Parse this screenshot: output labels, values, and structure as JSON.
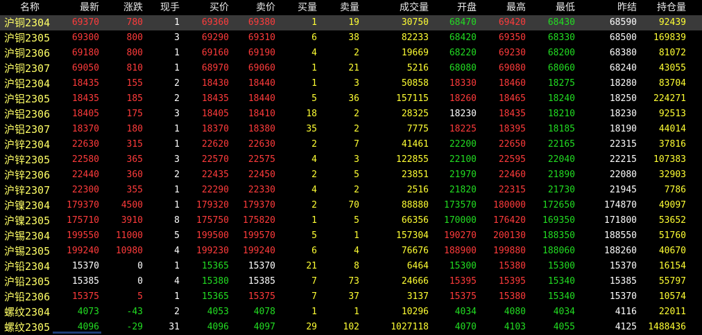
{
  "columns": [
    "名称",
    "最新",
    "涨跌",
    "现手",
    "买价",
    "卖价",
    "买量",
    "卖量",
    "成交量",
    "开盘",
    "最高",
    "最低",
    "昨结",
    "持仓量"
  ],
  "colors": {
    "up": "#ff3b3b",
    "down": "#22dd22",
    "flat": "#ffffff",
    "volume": "#ffff33",
    "name": "#ffff66",
    "selected_bg": "#3a3a3a"
  },
  "selected_row": 0,
  "rows": [
    {
      "name": "沪铜2304",
      "latest": "69370",
      "change": "780",
      "lot": "1",
      "bid": "69360",
      "ask": "69380",
      "bid_vol": "1",
      "ask_vol": "19",
      "volume": "30750",
      "open": "68470",
      "high": "69420",
      "low": "68430",
      "prev_settle": "68590",
      "open_interest": "92439",
      "dir": {
        "latest": "up",
        "change": "up",
        "bid": "up",
        "ask": "up",
        "open": "down",
        "high": "up",
        "low": "down"
      }
    },
    {
      "name": "沪铜2305",
      "latest": "69300",
      "change": "800",
      "lot": "3",
      "bid": "69290",
      "ask": "69310",
      "bid_vol": "6",
      "ask_vol": "38",
      "volume": "82233",
      "open": "68420",
      "high": "69350",
      "low": "68330",
      "prev_settle": "68500",
      "open_interest": "169839",
      "dir": {
        "latest": "up",
        "change": "up",
        "bid": "up",
        "ask": "up",
        "open": "down",
        "high": "up",
        "low": "down"
      }
    },
    {
      "name": "沪铜2306",
      "latest": "69180",
      "change": "800",
      "lot": "1",
      "bid": "69160",
      "ask": "69190",
      "bid_vol": "4",
      "ask_vol": "2",
      "volume": "19669",
      "open": "68220",
      "high": "69230",
      "low": "68200",
      "prev_settle": "68380",
      "open_interest": "81072",
      "dir": {
        "latest": "up",
        "change": "up",
        "bid": "up",
        "ask": "up",
        "open": "down",
        "high": "up",
        "low": "down"
      }
    },
    {
      "name": "沪铜2307",
      "latest": "69050",
      "change": "810",
      "lot": "1",
      "bid": "68970",
      "ask": "69060",
      "bid_vol": "1",
      "ask_vol": "21",
      "volume": "5216",
      "open": "68080",
      "high": "69080",
      "low": "68060",
      "prev_settle": "68240",
      "open_interest": "43055",
      "dir": {
        "latest": "up",
        "change": "up",
        "bid": "up",
        "ask": "up",
        "open": "down",
        "high": "up",
        "low": "down"
      }
    },
    {
      "name": "沪铝2304",
      "latest": "18435",
      "change": "155",
      "lot": "2",
      "bid": "18430",
      "ask": "18440",
      "bid_vol": "1",
      "ask_vol": "3",
      "volume": "50858",
      "open": "18330",
      "high": "18460",
      "low": "18275",
      "prev_settle": "18280",
      "open_interest": "83704",
      "dir": {
        "latest": "up",
        "change": "up",
        "bid": "up",
        "ask": "up",
        "open": "up",
        "high": "up",
        "low": "down"
      }
    },
    {
      "name": "沪铝2305",
      "latest": "18435",
      "change": "185",
      "lot": "2",
      "bid": "18435",
      "ask": "18440",
      "bid_vol": "5",
      "ask_vol": "36",
      "volume": "157115",
      "open": "18260",
      "high": "18465",
      "low": "18240",
      "prev_settle": "18250",
      "open_interest": "224271",
      "dir": {
        "latest": "up",
        "change": "up",
        "bid": "up",
        "ask": "up",
        "open": "up",
        "high": "up",
        "low": "down"
      }
    },
    {
      "name": "沪铝2306",
      "latest": "18405",
      "change": "175",
      "lot": "3",
      "bid": "18405",
      "ask": "18410",
      "bid_vol": "18",
      "ask_vol": "2",
      "volume": "28325",
      "open": "18230",
      "high": "18435",
      "low": "18210",
      "prev_settle": "18230",
      "open_interest": "92513",
      "dir": {
        "latest": "up",
        "change": "up",
        "bid": "up",
        "ask": "up",
        "open": "flat",
        "high": "up",
        "low": "down"
      }
    },
    {
      "name": "沪铝2307",
      "latest": "18370",
      "change": "180",
      "lot": "1",
      "bid": "18370",
      "ask": "18380",
      "bid_vol": "35",
      "ask_vol": "2",
      "volume": "7775",
      "open": "18225",
      "high": "18395",
      "low": "18185",
      "prev_settle": "18190",
      "open_interest": "44014",
      "dir": {
        "latest": "up",
        "change": "up",
        "bid": "up",
        "ask": "up",
        "open": "up",
        "high": "up",
        "low": "down"
      }
    },
    {
      "name": "沪锌2304",
      "latest": "22630",
      "change": "315",
      "lot": "1",
      "bid": "22620",
      "ask": "22630",
      "bid_vol": "2",
      "ask_vol": "7",
      "volume": "41461",
      "open": "22200",
      "high": "22650",
      "low": "22165",
      "prev_settle": "22315",
      "open_interest": "37816",
      "dir": {
        "latest": "up",
        "change": "up",
        "bid": "up",
        "ask": "up",
        "open": "down",
        "high": "up",
        "low": "down"
      }
    },
    {
      "name": "沪锌2305",
      "latest": "22580",
      "change": "365",
      "lot": "3",
      "bid": "22570",
      "ask": "22575",
      "bid_vol": "4",
      "ask_vol": "3",
      "volume": "122855",
      "open": "22100",
      "high": "22595",
      "low": "22040",
      "prev_settle": "22215",
      "open_interest": "107383",
      "dir": {
        "latest": "up",
        "change": "up",
        "bid": "up",
        "ask": "up",
        "open": "down",
        "high": "up",
        "low": "down"
      }
    },
    {
      "name": "沪锌2306",
      "latest": "22440",
      "change": "360",
      "lot": "2",
      "bid": "22435",
      "ask": "22450",
      "bid_vol": "2",
      "ask_vol": "5",
      "volume": "23851",
      "open": "21970",
      "high": "22460",
      "low": "21890",
      "prev_settle": "22080",
      "open_interest": "32903",
      "dir": {
        "latest": "up",
        "change": "up",
        "bid": "up",
        "ask": "up",
        "open": "down",
        "high": "up",
        "low": "down"
      }
    },
    {
      "name": "沪锌2307",
      "latest": "22300",
      "change": "355",
      "lot": "1",
      "bid": "22290",
      "ask": "22330",
      "bid_vol": "4",
      "ask_vol": "2",
      "volume": "2516",
      "open": "21820",
      "high": "22315",
      "low": "21730",
      "prev_settle": "21945",
      "open_interest": "7786",
      "dir": {
        "latest": "up",
        "change": "up",
        "bid": "up",
        "ask": "up",
        "open": "down",
        "high": "up",
        "low": "down"
      }
    },
    {
      "name": "沪镍2304",
      "latest": "179370",
      "change": "4500",
      "lot": "1",
      "bid": "179320",
      "ask": "179370",
      "bid_vol": "2",
      "ask_vol": "70",
      "volume": "88880",
      "open": "173570",
      "high": "180000",
      "low": "172650",
      "prev_settle": "174870",
      "open_interest": "49097",
      "dir": {
        "latest": "up",
        "change": "up",
        "bid": "up",
        "ask": "up",
        "open": "down",
        "high": "up",
        "low": "down"
      }
    },
    {
      "name": "沪镍2305",
      "latest": "175710",
      "change": "3910",
      "lot": "8",
      "bid": "175750",
      "ask": "175820",
      "bid_vol": "1",
      "ask_vol": "5",
      "volume": "66356",
      "open": "170000",
      "high": "176420",
      "low": "169350",
      "prev_settle": "171800",
      "open_interest": "53652",
      "dir": {
        "latest": "up",
        "change": "up",
        "bid": "up",
        "ask": "up",
        "open": "down",
        "high": "up",
        "low": "down"
      }
    },
    {
      "name": "沪锡2304",
      "latest": "199550",
      "change": "11000",
      "lot": "5",
      "bid": "199500",
      "ask": "199570",
      "bid_vol": "5",
      "ask_vol": "1",
      "volume": "157304",
      "open": "190270",
      "high": "200130",
      "low": "188350",
      "prev_settle": "188550",
      "open_interest": "51760",
      "dir": {
        "latest": "up",
        "change": "up",
        "bid": "up",
        "ask": "up",
        "open": "up",
        "high": "up",
        "low": "down"
      }
    },
    {
      "name": "沪锡2305",
      "latest": "199240",
      "change": "10980",
      "lot": "4",
      "bid": "199230",
      "ask": "199240",
      "bid_vol": "6",
      "ask_vol": "4",
      "volume": "76676",
      "open": "188900",
      "high": "199880",
      "low": "188060",
      "prev_settle": "188260",
      "open_interest": "40670",
      "dir": {
        "latest": "up",
        "change": "up",
        "bid": "up",
        "ask": "up",
        "open": "up",
        "high": "up",
        "low": "down"
      }
    },
    {
      "name": "沪铅2304",
      "latest": "15370",
      "change": "0",
      "lot": "1",
      "bid": "15365",
      "ask": "15370",
      "bid_vol": "21",
      "ask_vol": "8",
      "volume": "6464",
      "open": "15300",
      "high": "15380",
      "low": "15300",
      "prev_settle": "15370",
      "open_interest": "16154",
      "dir": {
        "latest": "flat",
        "change": "flat",
        "bid": "down",
        "ask": "flat",
        "open": "down",
        "high": "up",
        "low": "down"
      }
    },
    {
      "name": "沪铅2305",
      "latest": "15385",
      "change": "0",
      "lot": "4",
      "bid": "15380",
      "ask": "15385",
      "bid_vol": "7",
      "ask_vol": "73",
      "volume": "24666",
      "open": "15395",
      "high": "15395",
      "low": "15340",
      "prev_settle": "15385",
      "open_interest": "55797",
      "dir": {
        "latest": "flat",
        "change": "flat",
        "bid": "down",
        "ask": "flat",
        "open": "up",
        "high": "up",
        "low": "down"
      }
    },
    {
      "name": "沪铅2306",
      "latest": "15375",
      "change": "5",
      "lot": "1",
      "bid": "15365",
      "ask": "15375",
      "bid_vol": "7",
      "ask_vol": "37",
      "volume": "3137",
      "open": "15375",
      "high": "15380",
      "low": "15340",
      "prev_settle": "15370",
      "open_interest": "10574",
      "dir": {
        "latest": "up",
        "change": "up",
        "bid": "down",
        "ask": "up",
        "open": "up",
        "high": "up",
        "low": "down"
      }
    },
    {
      "name": "螺纹2304",
      "latest": "4073",
      "change": "-43",
      "lot": "2",
      "bid": "4053",
      "ask": "4078",
      "bid_vol": "1",
      "ask_vol": "1",
      "volume": "10296",
      "open": "4034",
      "high": "4080",
      "low": "4034",
      "prev_settle": "4116",
      "open_interest": "22011",
      "dir": {
        "latest": "down",
        "change": "down",
        "bid": "down",
        "ask": "down",
        "open": "down",
        "high": "down",
        "low": "down"
      }
    },
    {
      "name": "螺纹2305",
      "latest": "4096",
      "change": "-29",
      "lot": "31",
      "bid": "4096",
      "ask": "4097",
      "bid_vol": "29",
      "ask_vol": "102",
      "volume": "1027118",
      "open": "4070",
      "high": "4103",
      "low": "4055",
      "prev_settle": "4125",
      "open_interest": "1488436",
      "dir": {
        "latest": "down",
        "change": "down",
        "bid": "down",
        "ask": "down",
        "open": "down",
        "high": "down",
        "low": "down"
      }
    }
  ]
}
